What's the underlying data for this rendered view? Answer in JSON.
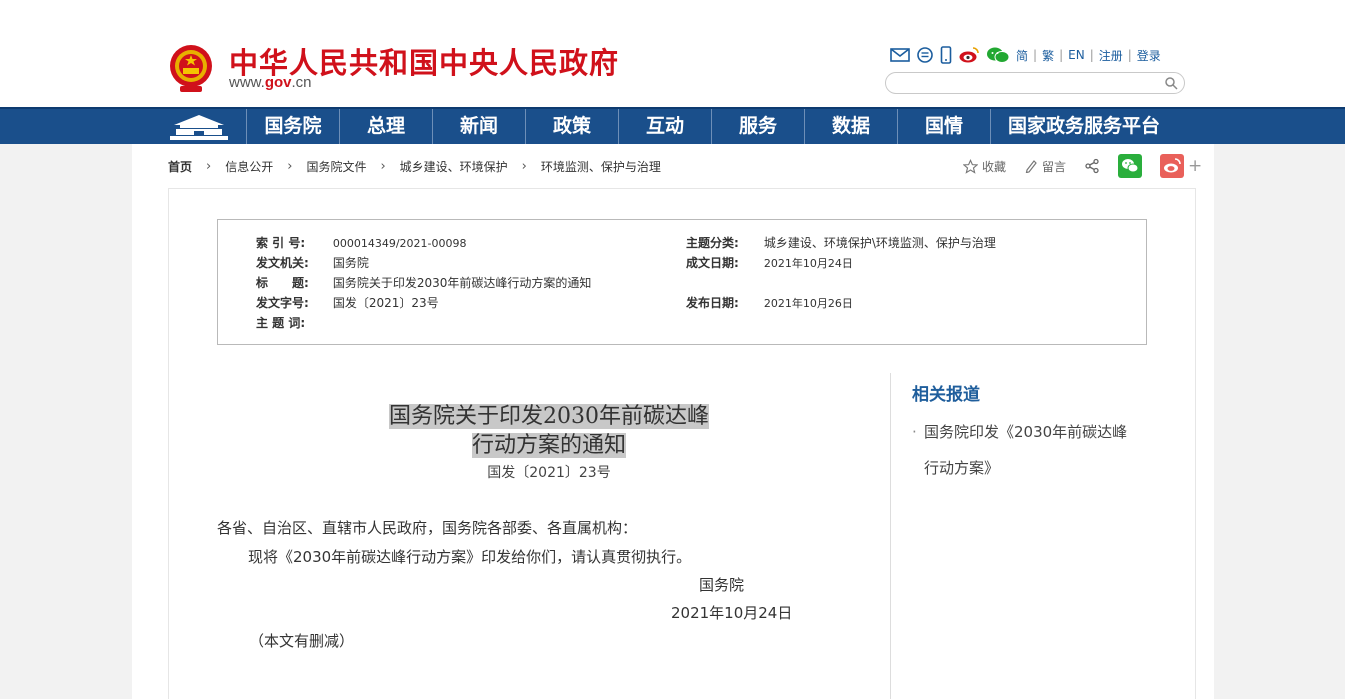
{
  "header": {
    "title": "中华人民共和国中央人民政府",
    "url_prefix": "www.",
    "url_domain": "gov",
    "url_suffix": ".cn",
    "links": [
      "简",
      "繁",
      "EN",
      "注册",
      "登录"
    ],
    "icons": [
      "mail-icon",
      "chat-icon",
      "mobile-icon",
      "weibo-icon",
      "wechat-icon"
    ],
    "search_placeholder": ""
  },
  "nav": {
    "items": [
      "国务院",
      "总理",
      "新闻",
      "政策",
      "互动",
      "服务",
      "数据",
      "国情",
      "国家政务服务平台"
    ]
  },
  "breadcrumb": {
    "items": [
      "首页",
      "信息公开",
      "国务院文件",
      "城乡建设、环境保护",
      "环境监测、保护与治理"
    ]
  },
  "tools": {
    "favorite": "收藏",
    "comment": "留言",
    "plus": "+"
  },
  "meta": {
    "index_label": "索 引 号:",
    "index_value": "000014349/2021-00098",
    "issuer_label": "发文机关:",
    "issuer_value": "国务院",
    "title_label": "标　　题:",
    "title_value": "国务院关于印发2030年前碳达峰行动方案的通知",
    "docno_label": "发文字号:",
    "docno_value": "国发〔2021〕23号",
    "keywords_label": "主 题 词:",
    "keywords_value": "",
    "category_label": "主题分类:",
    "category_value": "城乡建设、环境保护\\环境监测、保护与治理",
    "written_label": "成文日期:",
    "written_value": "2021年10月24日",
    "published_label": "发布日期:",
    "published_value": "2021年10月26日"
  },
  "article": {
    "title_line1": "国务院关于印发2030年前碳达峰",
    "title_line2": "行动方案的通知",
    "doc_number": "国发〔2021〕23号",
    "salutation": "各省、自治区、直辖市人民政府，国务院各部委、各直属机构：",
    "body": "现将《2030年前碳达峰行动方案》印发给你们，请认真贯彻执行。",
    "signer": "国务院",
    "date": "2021年10月24日",
    "note": "（本文有删减）"
  },
  "related": {
    "title": "相关报道",
    "items": [
      "国务院印发《2030年前碳达峰行动方案》"
    ]
  },
  "colors": {
    "brand_red": "#d0111b",
    "nav_blue": "#1a4f8b",
    "link_blue": "#1b5d9e"
  }
}
